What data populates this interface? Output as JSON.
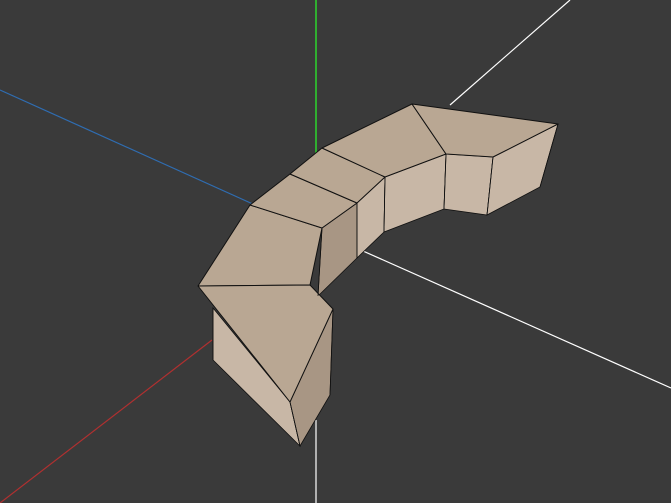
{
  "viewport": {
    "background_color": "#3a3a3a",
    "grid_color": "#2a2a2a",
    "axis_colors": {
      "x_positive": "#ffffff",
      "x_negative": "#b03030",
      "y_positive": "#ffffff",
      "y_negative": "#2f6db2",
      "z_positive": "#2ecc2e"
    }
  },
  "mesh": {
    "name": "",
    "top_color": "#b9a793",
    "side_color_light": "#c8b7a6",
    "side_color_dark": "#a89684",
    "edge_color": "#111111"
  }
}
